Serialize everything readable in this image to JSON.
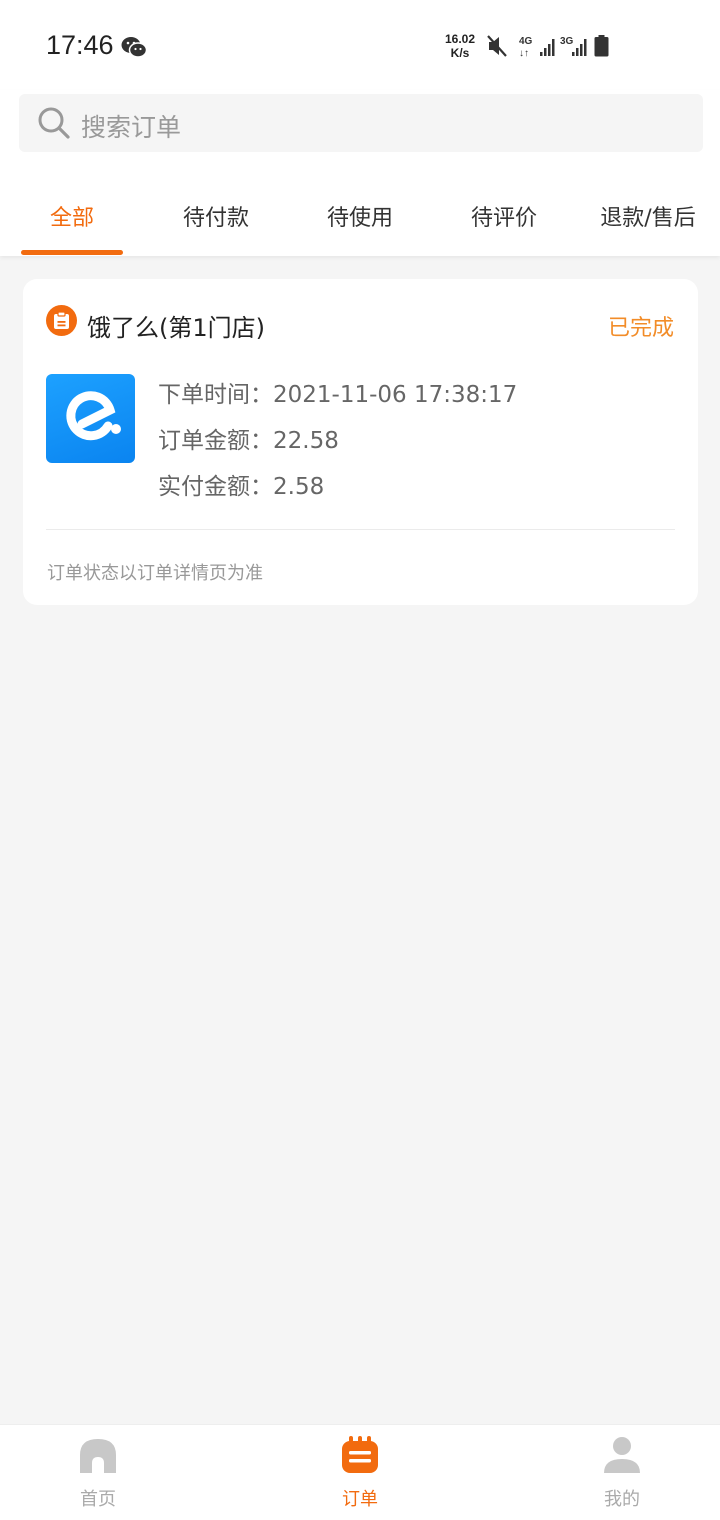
{
  "status_bar": {
    "time": "17:46",
    "speed_value": "16.02",
    "speed_unit": "K/s",
    "icons": [
      "wechat-icon",
      "mute-icon",
      "signal-4g-icon",
      "signal-3g-icon",
      "battery-icon"
    ]
  },
  "search": {
    "placeholder": "搜索订单"
  },
  "tabs": [
    {
      "label": "全部",
      "active": true
    },
    {
      "label": "待付款",
      "active": false
    },
    {
      "label": "待使用",
      "active": false
    },
    {
      "label": "待评价",
      "active": false
    },
    {
      "label": "退款/售后",
      "active": false
    }
  ],
  "order": {
    "shop_name": "饿了么(第1门店)",
    "status": "已完成",
    "order_time": "下单时间：2021-11-06 17:38:17",
    "order_amount": "订单金额：22.58",
    "paid_amount": "实付金额：2.58",
    "note": "订单状态以订单详情页为准"
  },
  "bottom_nav": [
    {
      "label": "首页",
      "icon": "home-icon",
      "active": false
    },
    {
      "label": "订单",
      "icon": "orders-icon",
      "active": true
    },
    {
      "label": "我的",
      "icon": "profile-icon",
      "active": false
    }
  ],
  "colors": {
    "accent": "#f26b0f",
    "status_text": "#f28c28",
    "background": "#f5f5f5",
    "logo_blue": "#1da1ff"
  }
}
